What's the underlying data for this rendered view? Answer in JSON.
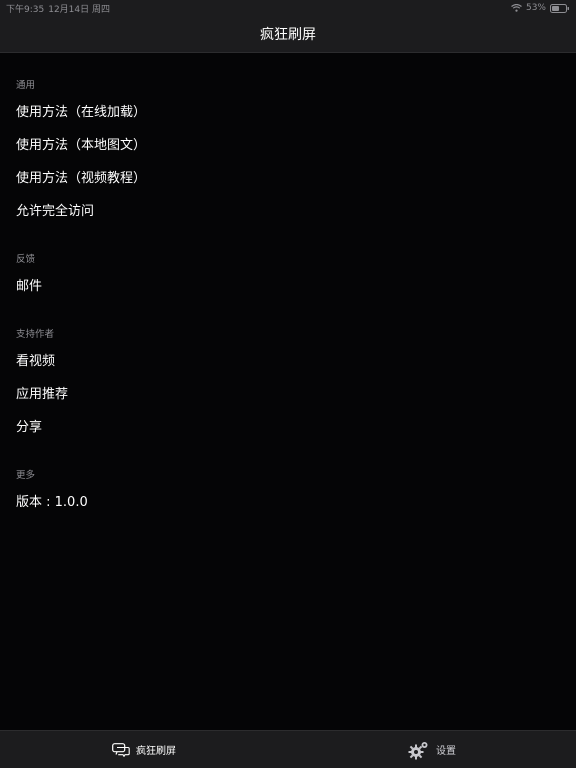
{
  "status_bar": {
    "time": "下午9:35",
    "date": "12月14日 周四",
    "battery": "53%"
  },
  "nav": {
    "title": "疯狂刷屏"
  },
  "sections": [
    {
      "header": "通用",
      "items": [
        "使用方法（在线加载）",
        "使用方法（本地图文）",
        "使用方法（视频教程）",
        "允许完全访问"
      ]
    },
    {
      "header": "反馈",
      "items": [
        "邮件"
      ]
    },
    {
      "header": "支持作者",
      "items": [
        "看视频",
        "应用推荐",
        "分享"
      ]
    },
    {
      "header": "更多",
      "items": [
        "版本 : 1.0.0"
      ]
    }
  ],
  "tabs": [
    {
      "label": "疯狂刷屏",
      "icon": "chat-bubbles-icon"
    },
    {
      "label": "设置",
      "icon": "gear-icon"
    }
  ],
  "colors": {
    "background": "#050506",
    "bar": "#1c1c1e",
    "text": "#ffffff",
    "secondary_text": "#8e8e93"
  }
}
